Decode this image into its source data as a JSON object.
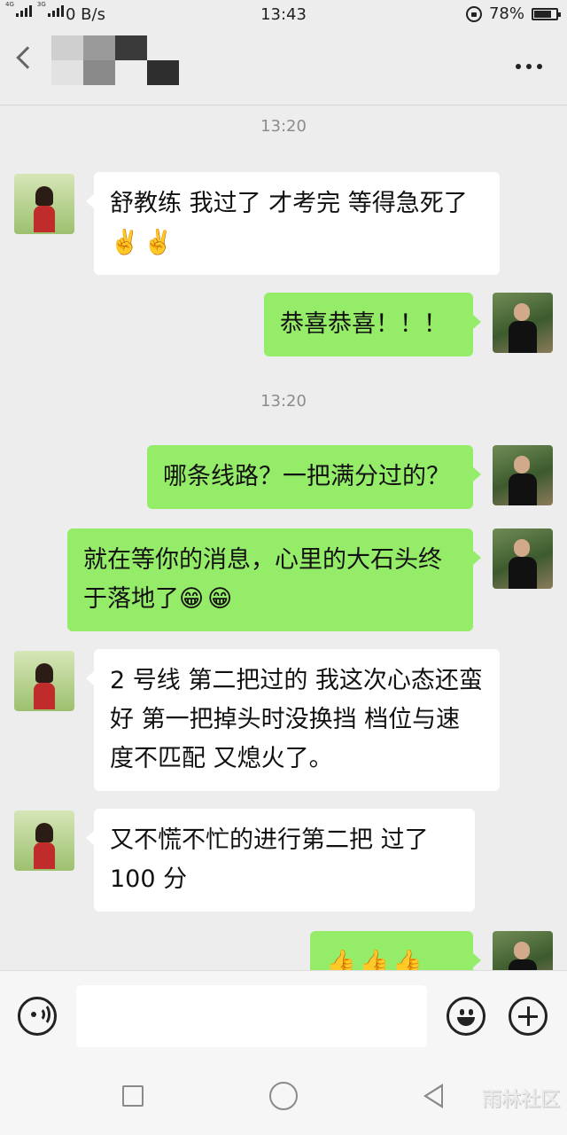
{
  "status_bar": {
    "signal_1_tag": "4G",
    "signal_2_tag": "3G",
    "net_speed": "0 B/s",
    "time": "13:43",
    "battery_percent": "78%",
    "battery_level": 0.78
  },
  "header": {
    "title_pixelated": true,
    "mosaic_colors": [
      "#cfcfcf",
      "#9a9a9a",
      "#3a3a3a",
      "#ededed",
      "#ededed",
      "#ededed",
      "#e2e2e2",
      "#8a8a8a",
      "#ededed",
      "#2e2e2e",
      "#ededed",
      "#ededed"
    ]
  },
  "chat": {
    "timestamps": [
      "13:20",
      "13:20"
    ],
    "messages": [
      {
        "from": "her",
        "text": "舒教练 我过了 才考完 等得急死了",
        "emojis": [
          "✌️",
          "✌️"
        ]
      },
      {
        "from": "me",
        "text": "恭喜恭喜！！！"
      },
      {
        "from": "me",
        "text": "哪条线路？一把满分过的？"
      },
      {
        "from": "me",
        "text": "就在等你的消息，心里的大石头终于落地了",
        "emojis": [
          "😁",
          "😁"
        ]
      },
      {
        "from": "her",
        "text": "2 号线 第二把过的 我这次心态还蛮好 第一把掉头时没换挡 档位与速度不匹配 又熄火了。"
      },
      {
        "from": "her",
        "text": "又不慌不忙的进行第二把 过了100 分"
      },
      {
        "from": "me",
        "text": "",
        "emojis": [
          "👍",
          "👍",
          "👍",
          "👍"
        ]
      }
    ]
  },
  "input_bar": {
    "voice_icon": "voice-icon",
    "emoji_icon": "emoji-icon",
    "plus_icon": "plus-icon",
    "text_value": ""
  },
  "nav_bar": {
    "watermark": "雨林社区"
  },
  "colors": {
    "background": "#ededed",
    "incoming_bubble": "#ffffff",
    "outgoing_bubble": "#95ec69",
    "timestamp": "#8c8c8c"
  }
}
